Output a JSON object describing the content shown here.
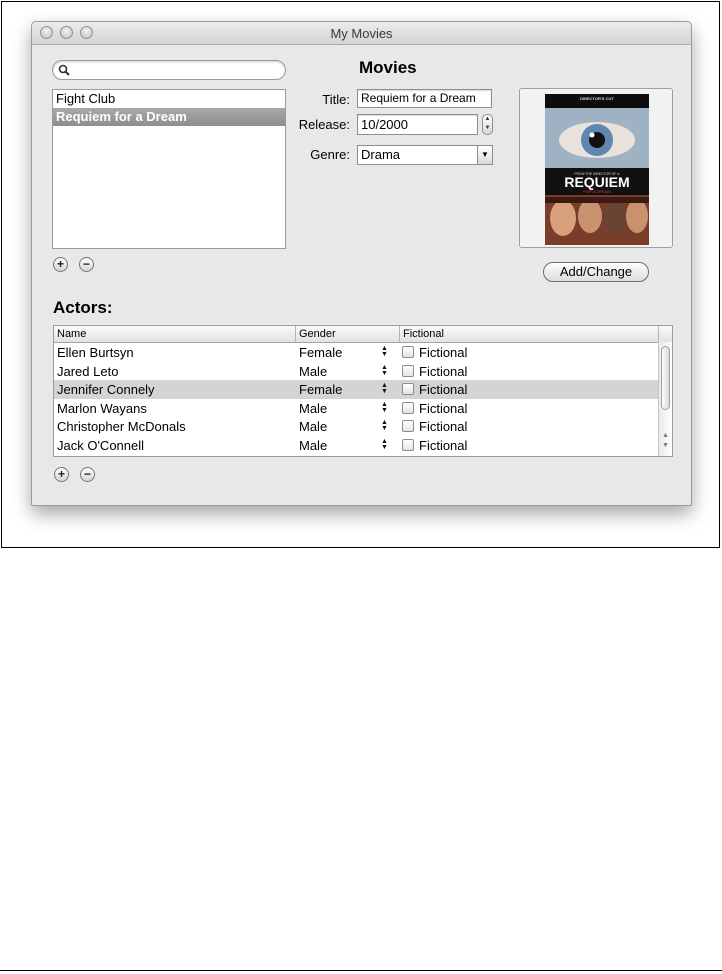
{
  "window": {
    "title": "My Movies"
  },
  "search": {
    "placeholder": "",
    "value": ""
  },
  "movies": {
    "heading": "Movies",
    "items": [
      {
        "label": "Fight Club",
        "selected": false
      },
      {
        "label": "Requiem for a Dream",
        "selected": true
      }
    ]
  },
  "details": {
    "title_label": "Title:",
    "title_value": "Requiem for a Dream",
    "release_label": "Release:",
    "release_value": "10/2000",
    "genre_label": "Genre:",
    "genre_value": "Drama"
  },
  "poster": {
    "top_text": "DIRECTOR'S CUT",
    "tag_text": "FROM THE DIRECTOR OF π",
    "title": "REQUIEM",
    "subtitle": "FOR A DREAM"
  },
  "add_change_label": "Add/Change",
  "actors": {
    "heading": "Actors:",
    "columns": [
      "Name",
      "Gender",
      "Fictional"
    ],
    "rows": [
      {
        "name": "Ellen Burtsyn",
        "gender": "Female",
        "fictional_label": "Fictional",
        "fictional": false,
        "selected": false
      },
      {
        "name": "Jared Leto",
        "gender": "Male",
        "fictional_label": "Fictional",
        "fictional": false,
        "selected": false
      },
      {
        "name": "Jennifer Connely",
        "gender": "Female",
        "fictional_label": "Fictional",
        "fictional": false,
        "selected": true
      },
      {
        "name": "Marlon Wayans",
        "gender": "Male",
        "fictional_label": "Fictional",
        "fictional": false,
        "selected": false
      },
      {
        "name": "Christopher McDonals",
        "gender": "Male",
        "fictional_label": "Fictional",
        "fictional": false,
        "selected": false
      },
      {
        "name": "Jack O'Connell",
        "gender": "Male",
        "fictional_label": "Fictional",
        "fictional": false,
        "selected": false
      }
    ]
  },
  "buttons": {
    "add": "+",
    "remove": "−"
  },
  "icons": {
    "search": "magnifier-icon",
    "stepper": "up-down-arrows-icon",
    "popup": "triangle-down-icon"
  }
}
